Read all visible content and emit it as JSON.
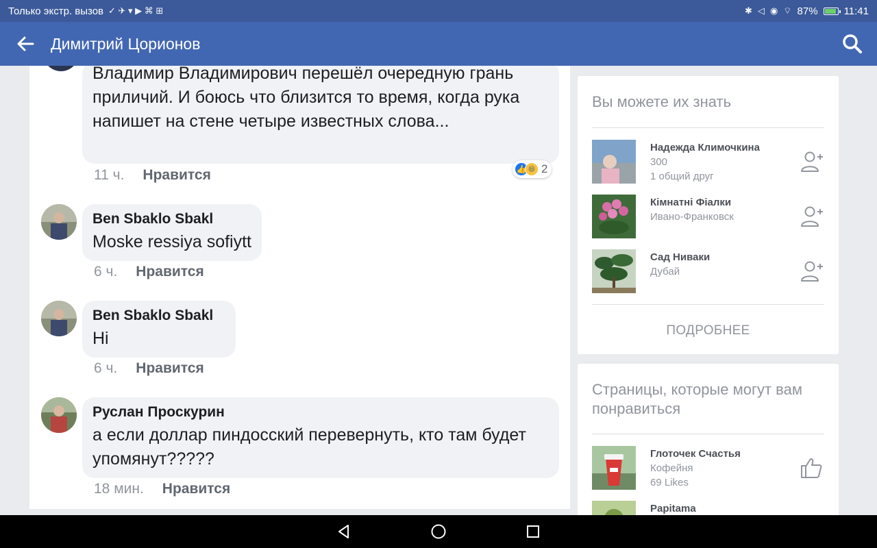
{
  "status_bar": {
    "carrier_text": "Только экстр. вызов",
    "battery": "87%",
    "time": "11:41"
  },
  "app_bar": {
    "title": "Димитрий Цорионов"
  },
  "comments": [
    {
      "author": "",
      "text": "Владимир Владимирович перешёл очередную грань приличий. И боюсь что близится то время, когда рука напишет на стене четыре известных слова...",
      "time": "11 ч.",
      "like_label": "Нравится",
      "reaction_count": "2"
    },
    {
      "author": "Ben Sbaklo Sbakl",
      "text": "Moske ressiya sofiytt",
      "time": "6 ч.",
      "like_label": "Нравится"
    },
    {
      "author": "Ben Sbaklo Sbakl",
      "text": "Hi",
      "time": "6 ч.",
      "like_label": "Нравится"
    },
    {
      "author": "Руслан Проскурин",
      "text": "а если доллар пиндосский перевернуть, кто там будет упомянут?????",
      "time": "18 мин.",
      "like_label": "Нравится"
    }
  ],
  "people_card": {
    "title": "Вы можете их знать",
    "people": [
      {
        "name": "Надежда Климочкина",
        "line1": "300",
        "line2": "1 общий друг"
      },
      {
        "name": "Кімнатні Фіалки",
        "line1": "Ивано-Франковск",
        "line2": ""
      },
      {
        "name": "Сад Ниваки",
        "line1": "Дубай",
        "line2": ""
      }
    ],
    "more_label": "ПОДРОБНЕЕ"
  },
  "pages_card": {
    "title": "Страницы, которые могут вам понравиться",
    "pages": [
      {
        "name": "Глоточек Счастья",
        "line1": "Кофейня",
        "line2": "69 Likes"
      },
      {
        "name": "Papitama",
        "line1": "",
        "line2": ""
      }
    ]
  },
  "icons": {
    "back": "arrow-left-icon",
    "search": "search-icon",
    "add_friend": "add-friend-icon",
    "like_page": "thumbs-up-icon",
    "nav_back": "triangle-back-icon",
    "nav_home": "circle-home-icon",
    "nav_recents": "square-recents-icon"
  },
  "colors": {
    "status_bar": "#3c5a99",
    "app_bar": "#4267b2",
    "background": "#e9ebee",
    "bubble": "#f0f2f5"
  }
}
